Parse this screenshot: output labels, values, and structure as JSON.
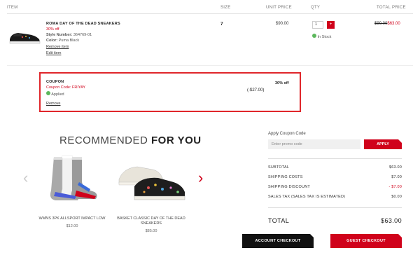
{
  "headers": {
    "item": "ITEM",
    "size": "SIZE",
    "unit_price": "UNIT PRICE",
    "qty": "QTY",
    "total_price": "TOTAL PRICE"
  },
  "cart_item": {
    "name": "ROMA DAY OF THE DEAD SNEAKERS",
    "discount": "30% off",
    "style_label": "Style Number:",
    "style_value": "364769-01",
    "color_label": "Color:",
    "color_value": "Puma Black",
    "remove_label": "Remove item",
    "edit_label": "Edit item",
    "size": "7",
    "unit_price": "$90.00",
    "qty": "1",
    "qty_btn": "+",
    "stock_status": "In Stock",
    "total_old": "$90.00",
    "total_new": "$63.00"
  },
  "coupon": {
    "title": "COUPON",
    "code_label": "Coupon Code: FRIYAY",
    "applied": "Applied",
    "remove": "Remove",
    "amount": "(-$27.00)",
    "discount": "30% off"
  },
  "recommended": {
    "title_light": "RECOMMENDED",
    "title_bold": "FOR YOU",
    "prev_arrow": "‹",
    "next_arrow": "›",
    "items": [
      {
        "name": "WMNS 3PK ALLSPORT IMPACT LOW",
        "price": "$12.00"
      },
      {
        "name": "BASKET CLASSIC DAY OF THE DEAD SNEAKERS",
        "price": "$85.00"
      }
    ]
  },
  "summary": {
    "coupon_label": "Apply Coupon Code",
    "promo_placeholder": "Enter promo code",
    "apply_btn": "APPLY",
    "subtotal_label": "SUBTOTAL",
    "subtotal_value": "$63.00",
    "shipping_label": "SHIPPING COSTS",
    "shipping_value": "$7.00",
    "ship_disc_label": "SHIPPING DISCOUNT",
    "ship_disc_value": "- $7.00",
    "tax_label": "SALES TAX (SALES TAX IS ESTIMATED)",
    "tax_value": "$0.00",
    "total_label": "TOTAL",
    "total_value": "$63.00",
    "account_checkout": "ACCOUNT CHECKOUT",
    "guest_checkout": "GUEST CHECKOUT"
  },
  "colors": {
    "accent": "#d0021b",
    "instock": "#5cb85c",
    "coupon_border": "#e0262b"
  },
  "icons": {
    "check": "check-circle-icon",
    "arrow_left": "chevron-left-icon",
    "arrow_right": "chevron-right-icon"
  }
}
